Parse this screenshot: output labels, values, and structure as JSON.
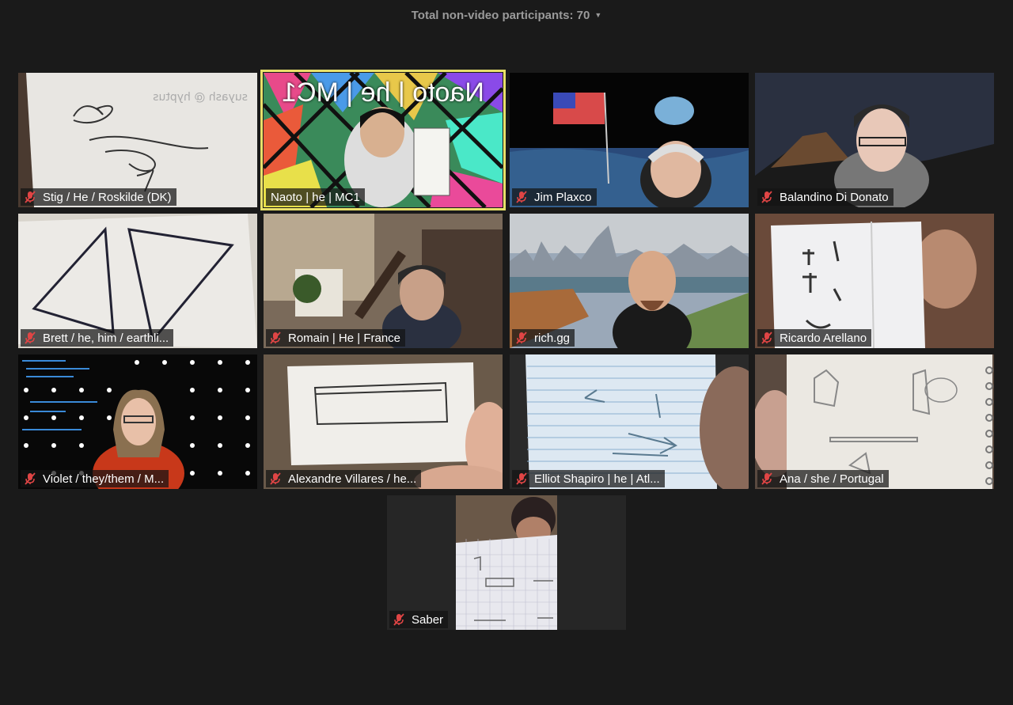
{
  "header": {
    "participants_text": "Total non-video participants: 70"
  },
  "overlay_text": "Naoto | he | MC1",
  "participants": [
    {
      "name": "Stig / He / Roskilde (DK)",
      "muted": true
    },
    {
      "name": "Naoto | he | MC1",
      "muted": false,
      "active_speaker": true
    },
    {
      "name": "Jim Plaxco",
      "muted": true
    },
    {
      "name": "Balandino Di Donato",
      "muted": true
    },
    {
      "name": "Brett / he, him / earthli...",
      "muted": true
    },
    {
      "name": "Romain | He | France",
      "muted": true
    },
    {
      "name": "rich.gg",
      "muted": true
    },
    {
      "name": "Ricardo Arellano",
      "muted": true
    },
    {
      "name": "Violet / they/them / M...",
      "muted": true
    },
    {
      "name": "Alexandre Villares / he...",
      "muted": true
    },
    {
      "name": "Elliot Shapiro | he | Atl...",
      "muted": true
    },
    {
      "name": "Ana / she / Portugal",
      "muted": true
    },
    {
      "name": "Saber",
      "muted": true
    }
  ],
  "colors": {
    "background": "#1a1a1a",
    "active_border": "#e8e06a",
    "muted_icon": "#e04545"
  }
}
